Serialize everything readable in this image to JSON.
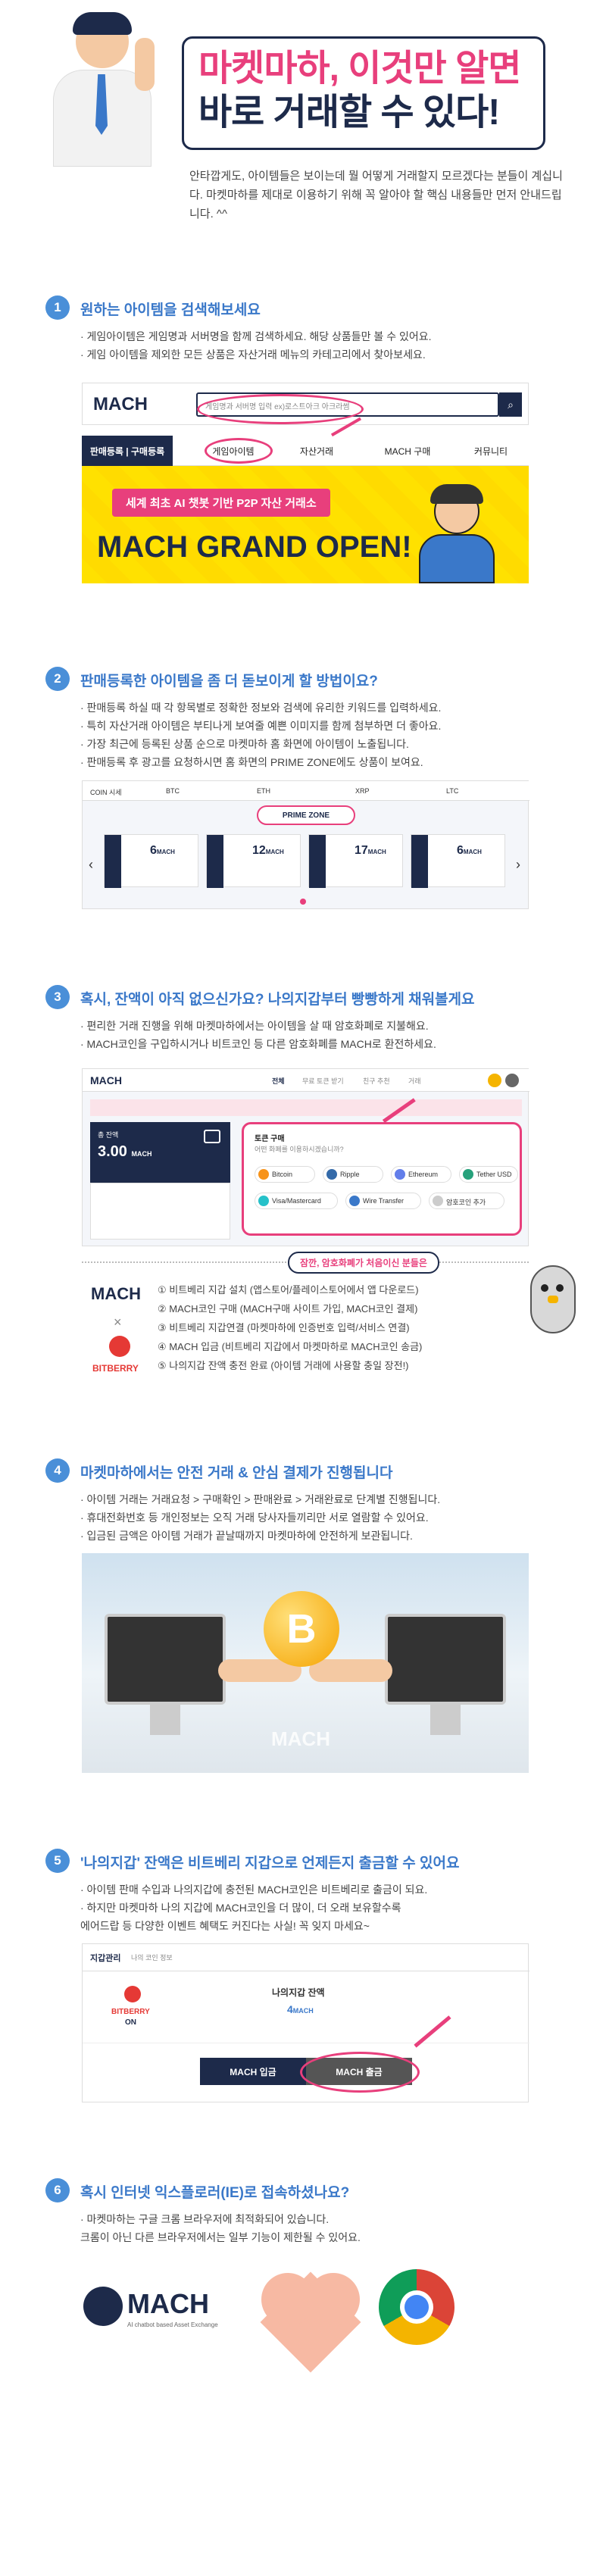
{
  "hero": {
    "title_line1": "마켓마하, 이것만 알면",
    "title_line2": "바로 거래할 수 있다!",
    "intro": "안타깝게도, 아이템들은 보이는데 뭘 어떻게 거래할지 모르겠다는 분들이 계십니다. 마켓마하를 제대로 이용하기 위해 꼭 알아야 할 핵심 내용들만 먼저 안내드립니다. ^^"
  },
  "s1": {
    "num": "1",
    "title": "원하는 아이템을 검색해보세요",
    "bullets": [
      "· 게임아이템은 게임명과 서버명을 함께 검색하세요. 해당 상품들만 볼 수 있어요.",
      "· 게임 아이템을 제외한 모든 상품은 자산거래 메뉴의 카테고리에서 찾아보세요."
    ],
    "logo": "MACH",
    "search_placeholder": "게임명과 서버명 입력 ex)로스트아크 아크라썸",
    "nav_left": "판매등록 | 구매등록",
    "nav_tabs": [
      "게임아이템",
      "자산거래",
      "MACH 구매",
      "커뮤니티"
    ],
    "banner_pill": "세계 최초 AI 챗봇 기반 P2P 자산 거래소",
    "banner_big": "MACH GRAND OPEN!"
  },
  "s2": {
    "num": "2",
    "title": "판매등록한 아이템을 좀 더 돋보이게 할 방법이요?",
    "bullets": [
      "· 판매등록 하실 때 각 항목별로 정확한 정보와 검색에 유리한 키워드를 입력하세요.",
      "· 특히 자산거래 아이템은 부티나게 보여줄 예쁜 이미지를 함께 첨부하면 더 좋아요.",
      "· 가장 최근에 등록된 상품 순으로 마켓마하 홈 화면에 아이템이 노출됩니다.",
      "· 판매등록 후 광고를 요청하시면 홈 화면의 PRIME ZONE에도 상품이 보여요."
    ],
    "ticker": [
      "COIN 시세",
      "BTC",
      "ETH",
      "XRP",
      "LTC"
    ],
    "prime_zone": "PRIME ZONE",
    "cards": [
      {
        "price": "6",
        "unit": "MACH"
      },
      {
        "price": "12",
        "unit": "MACH"
      },
      {
        "price": "17",
        "unit": "MACH"
      },
      {
        "price": "6",
        "unit": "MACH"
      }
    ]
  },
  "s3": {
    "num": "3",
    "title": "혹시, 잔액이 아직 없으신가요? 나의지갑부터 빵빵하게 채워볼게요",
    "bullets": [
      "· 편리한 거래 진행을 위해 마켓마하에서는 아이템을 살 때 암호화폐로 지불해요.",
      "· MACH코인을 구입하시거나 비트코인 등 다른 암호화폐를 MACH로 환전하세요."
    ],
    "wallet_logo": "MACH",
    "wallet_tabs": [
      "전체",
      "무료 토큰 받기",
      "친구 추천",
      "거래"
    ],
    "balance_label": "총 잔액",
    "balance": "3.00",
    "balance_unit": "MACH",
    "buy_title": "토큰 구매",
    "buy_sub": "어떤 화폐를 이용하시겠습니까?",
    "coins": [
      "Bitcoin",
      "Ripple",
      "Ethereum",
      "Tether USD",
      "Visa/Mastercard",
      "Wire Transfer",
      "암호코인 추가"
    ],
    "tip_title": "잠깐, 암호화폐가 처음이신 분들은",
    "steps": [
      "① 비트베리 지갑 설치 (앱스토어/플레이스토어에서 앱 다운로드)",
      "② MACH코인 구매 (MACH구매 사이트 가입, MACH코인 결제)",
      "③ 비트베리 지갑연결 (마켓마하에 인증번호 입력/서비스 연결)",
      "④ MACH 입금 (비트베리 지갑에서 마켓마하로 MACH코인 송금)",
      "⑤ 나의지갑 잔액 충전 완료 (아이템 거래에 사용할 충일 장전!)"
    ],
    "brand_mach": "MACH",
    "brand_x": "×",
    "brand_bitberry": "BITBERRY"
  },
  "s4": {
    "num": "4",
    "title": "마켓마하에서는 안전 거래 & 안심 결제가 진행됩니다",
    "bullets": [
      "· 아이템 거래는 거래요청 > 구매확인 > 판매완료 > 거래완료로 단계별 진행됩니다.",
      "· 휴대전화번호 등 개인정보는 오직 거래 당사자들끼리만 서로 열람할 수 있어요.",
      "· 입금된 금액은 아이템 거래가 끝날때까지 마켓마하에 안전하게 보관됩니다."
    ],
    "coin_letter": "B",
    "img_logo": "MACH"
  },
  "s5": {
    "num": "5",
    "title": "'나의지갑' 잔액은 비트베리 지갑으로 언제든지 출금할 수 있어요",
    "bullets": [
      "· 아이템 판매 수입과 나의지갑에 충전된 MACH코인은 비트베리로 출금이 되요.",
      "· 하지만 마켓마하 나의 지갑에 MACH코인을 더 많이, 더 오래 보유할수록",
      "  에어드랍 등 다양한 이벤트 혜택도 커진다는 사실! 꼭 잊지 마세요~"
    ],
    "wallet_mgmt": "지갑관리",
    "wallet_mgmt_sub": "나의 코인 정보",
    "bitberry": "BITBERRY",
    "on": "ON",
    "my_balance": "나의지갑 잔액",
    "amount": "4",
    "amount_unit": "MACH",
    "deposit": "MACH 입금",
    "withdraw": "MACH 출금"
  },
  "s6": {
    "num": "6",
    "title": "혹시 인터넷 익스플로러(IE)로 접속하셨나요?",
    "bullets": [
      "· 마켓마하는 구글 크롬 브라우저에 최적화되어 있습니다.",
      "  크롬이 아닌 다른 브라우저에서는 일부 기능이 제한될 수 있어요."
    ],
    "logo": "MACH",
    "logo_sub": "AI chatbot based Asset Exchange"
  }
}
